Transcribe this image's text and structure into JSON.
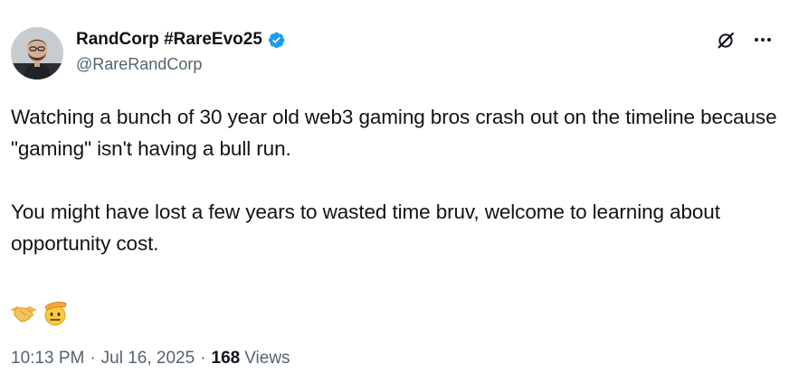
{
  "author": {
    "display_name": "RandCorp #RareEvo25",
    "handle": "@RareRandCorp",
    "verified": true,
    "avatar_icon": "profile-photo",
    "verified_icon": "verified-badge-icon",
    "verified_color": "#1d9bf0"
  },
  "actions": {
    "grok_icon": "grok-icon",
    "more_icon": "more-options-icon"
  },
  "tweet": {
    "paragraphs": [
      "Watching a bunch of 30 year old web3 gaming bros crash out on the timeline because \"gaming\" isn't having a bull run.",
      "You might have lost a few years to wasted time bruv, welcome to learning about opportunity cost."
    ],
    "emojis": [
      "handshake",
      "saluting-face"
    ]
  },
  "meta": {
    "time": "10:13 PM",
    "separator": "·",
    "date": "Jul 16, 2025",
    "views_count": "168",
    "views_label": "Views"
  },
  "colors": {
    "text": "#0f1419",
    "secondary": "#536471",
    "accent": "#1d9bf0"
  }
}
